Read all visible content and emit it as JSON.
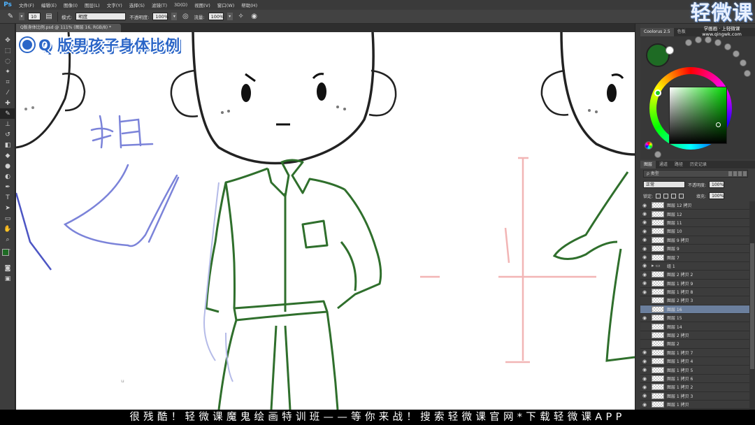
{
  "app": {
    "logo": "Ps"
  },
  "menu": [
    "文件(F)",
    "编辑(E)",
    "图像(I)",
    "图层(L)",
    "文字(Y)",
    "选择(S)",
    "滤镜(T)",
    "3D(D)",
    "视图(V)",
    "窗口(W)",
    "帮助(H)"
  ],
  "options": {
    "brush_size": "10",
    "mode_label": "模式:",
    "mode_value": "明度",
    "opacity_label": "不透明度:",
    "opacity_value": "100%",
    "flow_label": "流量:",
    "flow_value": "100%"
  },
  "document": {
    "tab_title": "Q版身体比例.psd @ 111% (图层 16, RGB/8) *"
  },
  "canvas": {
    "title": "Q 版男孩子身体比例"
  },
  "watermark": {
    "brand": "轻微课",
    "slogan": "学画画 · 上轻微课",
    "url": "www.qingwk.com"
  },
  "color_panel": {
    "tabs": [
      "Coolorus 2.5",
      "色板"
    ],
    "current_color": "#1e6b24",
    "hue_color": "#00d900"
  },
  "layers_panel": {
    "tabs": [
      "图层",
      "通道",
      "路径",
      "历史记录"
    ],
    "filter_label": "ρ 类型",
    "blend_mode": "正常",
    "opacity_label": "不透明度:",
    "opacity_value": "100%",
    "lock_label": "锁定:",
    "fill_label": "填充:",
    "fill_value": "100%",
    "layers": [
      {
        "name": "图层 12 拷贝",
        "visible": true,
        "selected": false,
        "folder": false
      },
      {
        "name": "图层 12",
        "visible": true,
        "selected": false,
        "folder": false
      },
      {
        "name": "图层 11",
        "visible": true,
        "selected": false,
        "folder": false
      },
      {
        "name": "图层 10",
        "visible": true,
        "selected": false,
        "folder": false
      },
      {
        "name": "图层 9 拷贝",
        "visible": true,
        "selected": false,
        "folder": false
      },
      {
        "name": "图层 9",
        "visible": true,
        "selected": false,
        "folder": false
      },
      {
        "name": "图层 7",
        "visible": true,
        "selected": false,
        "folder": false
      },
      {
        "name": "组 1",
        "visible": true,
        "selected": false,
        "folder": true
      },
      {
        "name": "图层 2 拷贝 2",
        "visible": true,
        "selected": false,
        "folder": false
      },
      {
        "name": "图层 1 拷贝 9",
        "visible": true,
        "selected": false,
        "folder": false
      },
      {
        "name": "图层 1 拷贝 8",
        "visible": true,
        "selected": false,
        "folder": false
      },
      {
        "name": "图层 2 拷贝 3",
        "visible": false,
        "selected": false,
        "folder": false
      },
      {
        "name": "图层 16",
        "visible": false,
        "selected": true,
        "folder": false
      },
      {
        "name": "图层 15",
        "visible": true,
        "selected": false,
        "folder": false
      },
      {
        "name": "图层 14",
        "visible": false,
        "selected": false,
        "folder": false
      },
      {
        "name": "图层 2 拷贝",
        "visible": false,
        "selected": false,
        "folder": false
      },
      {
        "name": "图层 2",
        "visible": false,
        "selected": false,
        "folder": false
      },
      {
        "name": "图层 1 拷贝 7",
        "visible": true,
        "selected": false,
        "folder": false
      },
      {
        "name": "图层 1 拷贝 4",
        "visible": true,
        "selected": false,
        "folder": false
      },
      {
        "name": "图层 1 拷贝 5",
        "visible": true,
        "selected": false,
        "folder": false
      },
      {
        "name": "图层 1 拷贝 6",
        "visible": true,
        "selected": false,
        "folder": false
      },
      {
        "name": "图层 1 拷贝 2",
        "visible": true,
        "selected": false,
        "folder": false
      },
      {
        "name": "图层 1 拷贝 3",
        "visible": true,
        "selected": false,
        "folder": false
      },
      {
        "name": "图层 1 拷贝",
        "visible": true,
        "selected": false,
        "folder": false
      }
    ]
  },
  "subtitle": "很残酷！轻微课魔鬼绘画特训班——等你来战！搜索轻微课官网*下载轻微课APP"
}
